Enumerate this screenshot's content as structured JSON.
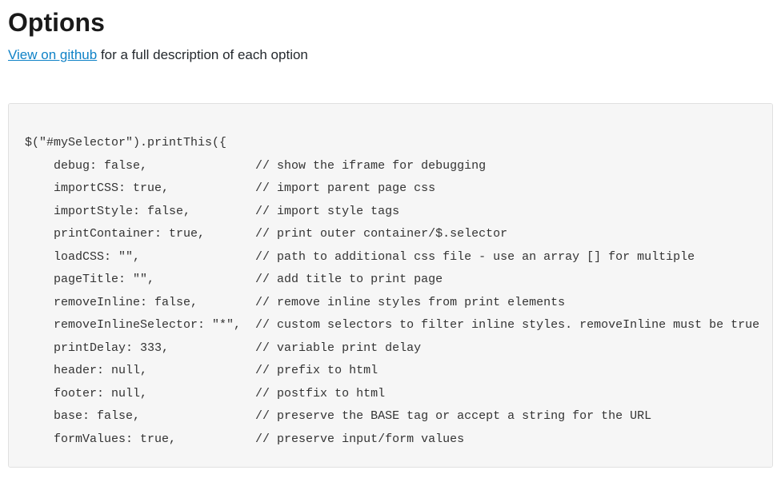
{
  "heading": "Options",
  "link_text": "View on github",
  "subtitle_rest": " for a full description of each option",
  "code": "$(\"#mySelector\").printThis({\n    debug: false,               // show the iframe for debugging\n    importCSS: true,            // import parent page css\n    importStyle: false,         // import style tags\n    printContainer: true,       // print outer container/$.selector\n    loadCSS: \"\",                // path to additional css file - use an array [] for multiple\n    pageTitle: \"\",              // add title to print page\n    removeInline: false,        // remove inline styles from print elements\n    removeInlineSelector: \"*\",  // custom selectors to filter inline styles. removeInline must be true\n    printDelay: 333,            // variable print delay\n    header: null,               // prefix to html\n    footer: null,               // postfix to html\n    base: false,                // preserve the BASE tag or accept a string for the URL\n    formValues: true,           // preserve input/form values"
}
